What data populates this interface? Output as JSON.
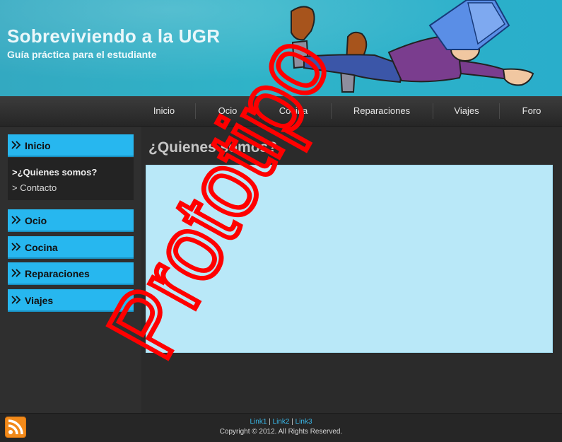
{
  "header": {
    "title": "Sobreviviendo a la UGR",
    "subtitle": "Guía práctica para el estudiante"
  },
  "nav": {
    "items": [
      "Inicio",
      "Ocio",
      "Cocina",
      "Reparaciones",
      "Viajes",
      "Foro"
    ]
  },
  "sidebar": {
    "sections": [
      "Inicio",
      "Ocio",
      "Cocina",
      "Reparaciones",
      "Viajes"
    ],
    "submenu": [
      ">¿Quienes somos?",
      "> Contacto"
    ]
  },
  "main": {
    "title": "¿Quienes somos?"
  },
  "watermark": {
    "text": "Prototipo",
    "color": "#ff0000"
  },
  "footer": {
    "links": [
      "Link1",
      "Link2",
      "Link3"
    ],
    "separator": "|",
    "copyright": "Copyright © 2012. All Rights Reserved."
  },
  "colors": {
    "accent": "#27b7ef",
    "content_bg": "#b9e8f8",
    "header_bg": "#2fb3c8",
    "page_bg": "#2b2b2b"
  },
  "icons": {
    "sidebar": "double-chevron-right-icon",
    "footer": "rss-feed-icon"
  }
}
